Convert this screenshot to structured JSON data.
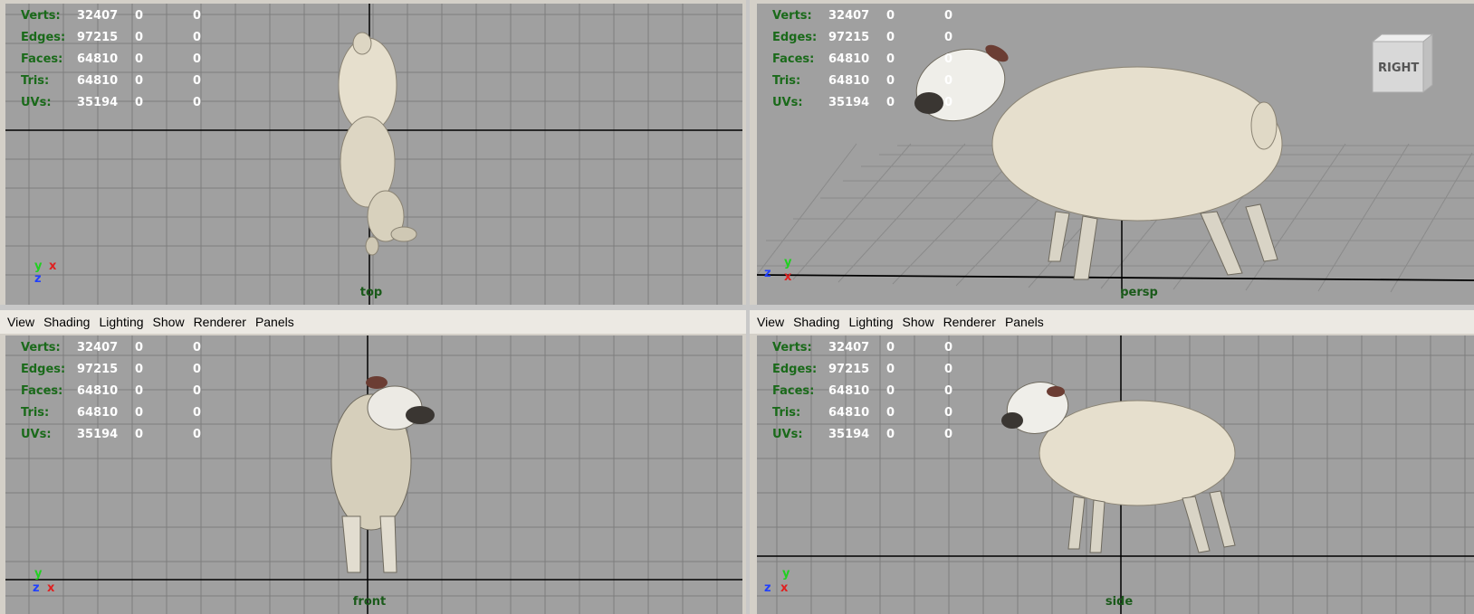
{
  "menu": [
    "View",
    "Shading",
    "Lighting",
    "Show",
    "Renderer",
    "Panels"
  ],
  "hud": {
    "rows": [
      {
        "label": "Verts:",
        "v1": "32407",
        "v2": "0",
        "v3": "0"
      },
      {
        "label": "Edges:",
        "v1": "97215",
        "v2": "0",
        "v3": "0"
      },
      {
        "label": "Faces:",
        "v1": "64810",
        "v2": "0",
        "v3": "0"
      },
      {
        "label": "Tris:",
        "v1": "64810",
        "v2": "0",
        "v3": "0"
      },
      {
        "label": "UVs:",
        "v1": "35194",
        "v2": "0",
        "v3": "0"
      }
    ]
  },
  "viewports": {
    "top": {
      "camera": "top"
    },
    "persp": {
      "camera": "persp",
      "viewcube": "RIGHT"
    },
    "front": {
      "camera": "front"
    },
    "side": {
      "camera": "side"
    }
  },
  "axes": {
    "x": "x",
    "y": "y",
    "z": "z"
  },
  "colors": {
    "viewport_bg": "#a0a0a0",
    "grid": "#7e7e7e",
    "hud_label": "#1a6a1a",
    "axis_x": "#e02020",
    "axis_y": "#20d020",
    "axis_z": "#2040ff"
  }
}
